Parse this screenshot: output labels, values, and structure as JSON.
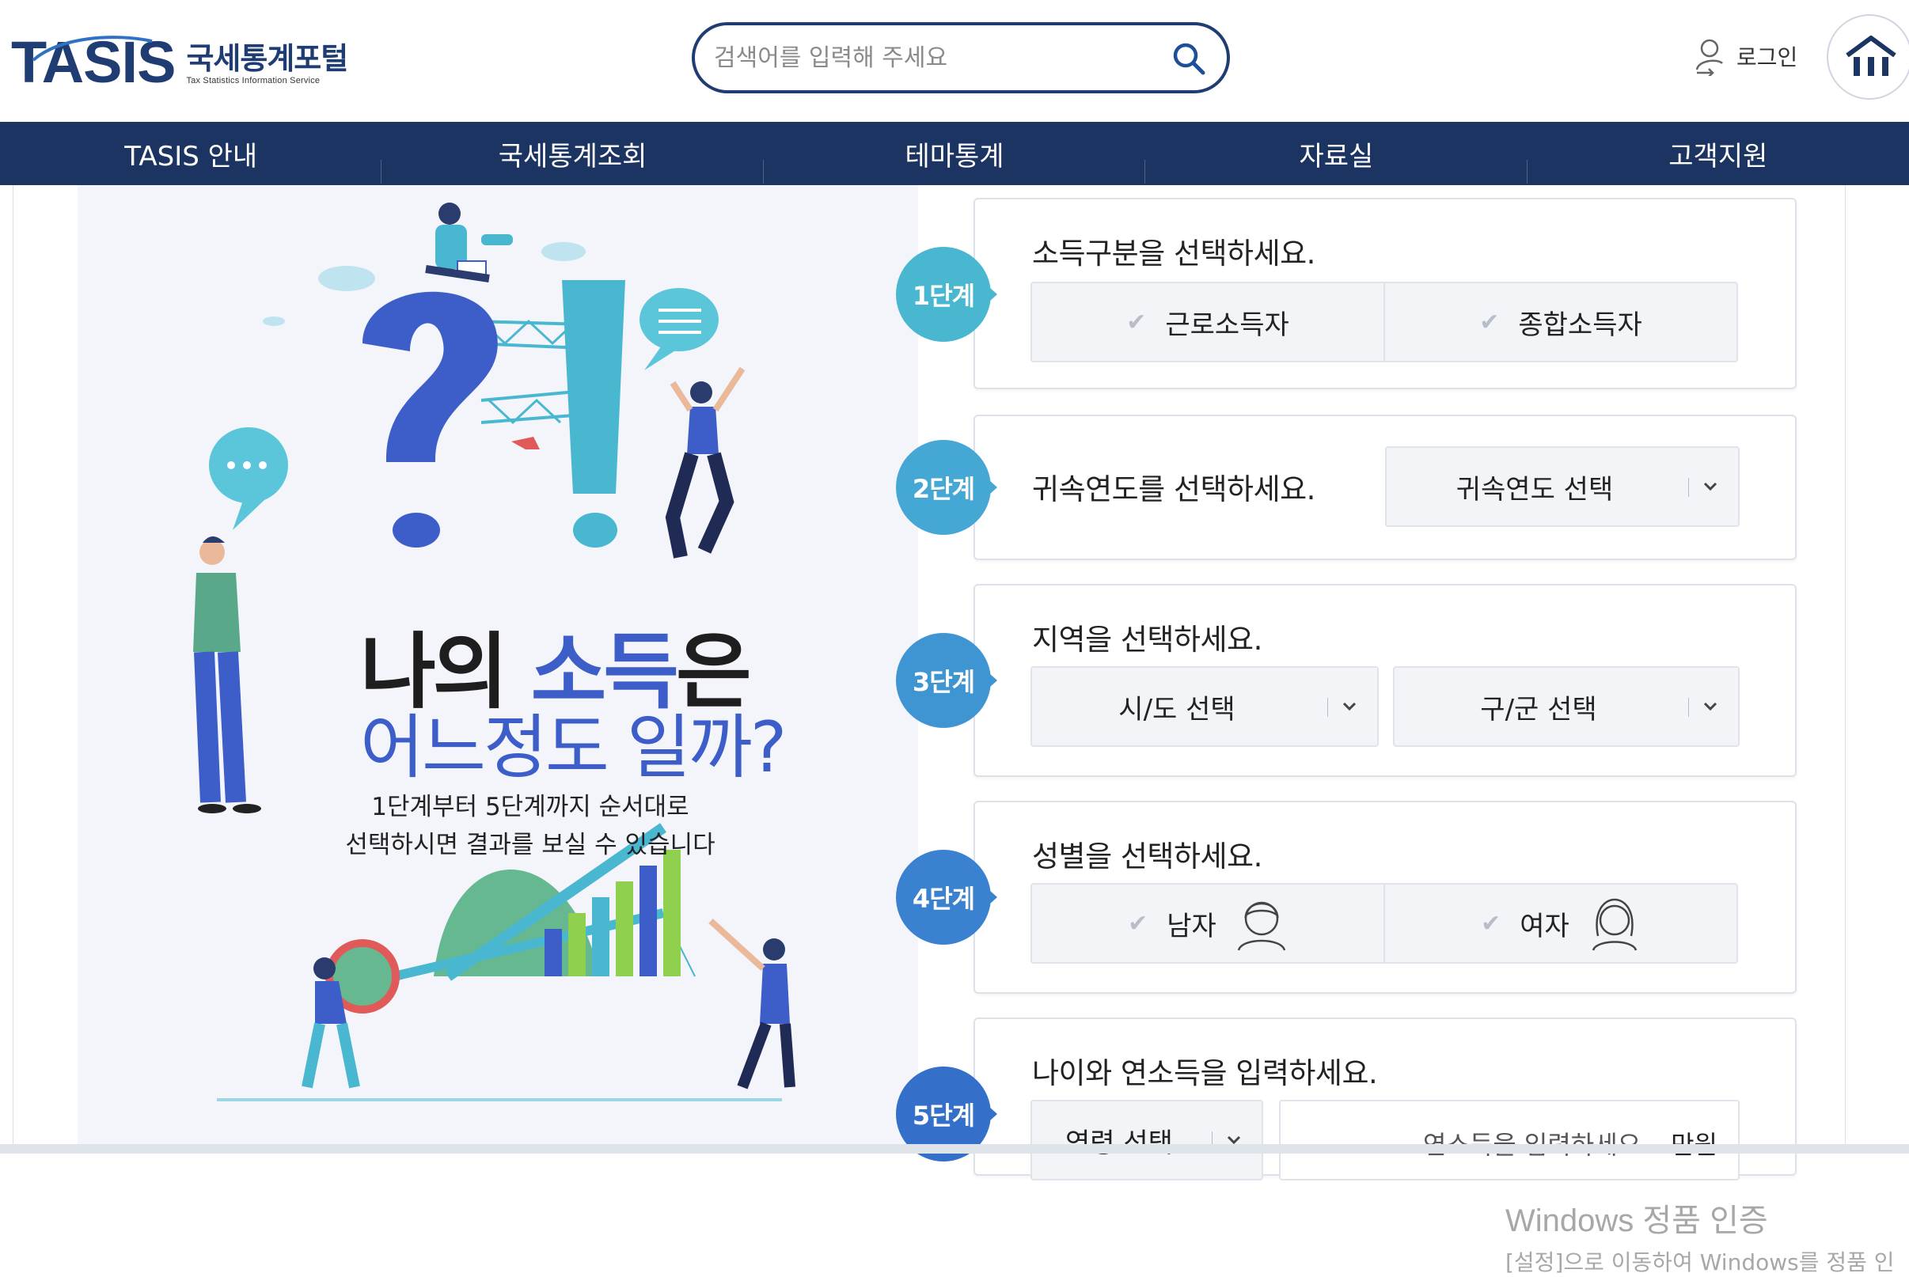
{
  "header": {
    "logo": {
      "brand": "TASIS",
      "kr": "국세통계포털",
      "en": "Tax Statistics Information Service"
    },
    "search": {
      "placeholder": "검색어를 입력해 주세요"
    },
    "login_label": "로그인"
  },
  "nav": {
    "items": [
      "TASIS 안내",
      "국세통계조회",
      "테마통계",
      "자료실",
      "고객지원"
    ]
  },
  "hero": {
    "title_part1": "나의 ",
    "title_highlight": "소득",
    "title_part2": "은",
    "title_line2": "어느정도 일까?",
    "sub_line1": "1단계부터 5단계까지 순서대로",
    "sub_line2": "선택하시면 결과를 보실 수 있습니다"
  },
  "steps": [
    {
      "badge": "1단계",
      "question": "소득구분을 선택하세요.",
      "options": [
        "근로소득자",
        "종합소득자"
      ]
    },
    {
      "badge": "2단계",
      "question": "귀속연도를 선택하세요.",
      "select": "귀속연도 선택"
    },
    {
      "badge": "3단계",
      "question": "지역을 선택하세요.",
      "selects": [
        "시/도 선택",
        "구/군 선택"
      ]
    },
    {
      "badge": "4단계",
      "question": "성별을 선택하세요.",
      "options": [
        "남자",
        "여자"
      ]
    },
    {
      "badge": "5단계",
      "question": "나이와 연소득을 입력하세요.",
      "select": "연령 선택",
      "input_placeholder": "연소득을 입력하세요",
      "unit": "만원"
    }
  ],
  "watermark": {
    "line1": "Windows 정품 인증",
    "line2": "[설정]으로 이동하여 Windows를 정품 인"
  },
  "colors": {
    "navy": "#1b3461",
    "badge1": "#4ab7d1",
    "badge2": "#45a8d4",
    "badge3": "#3f95d2",
    "badge4": "#3a82cf",
    "badge5": "#3470c9"
  }
}
